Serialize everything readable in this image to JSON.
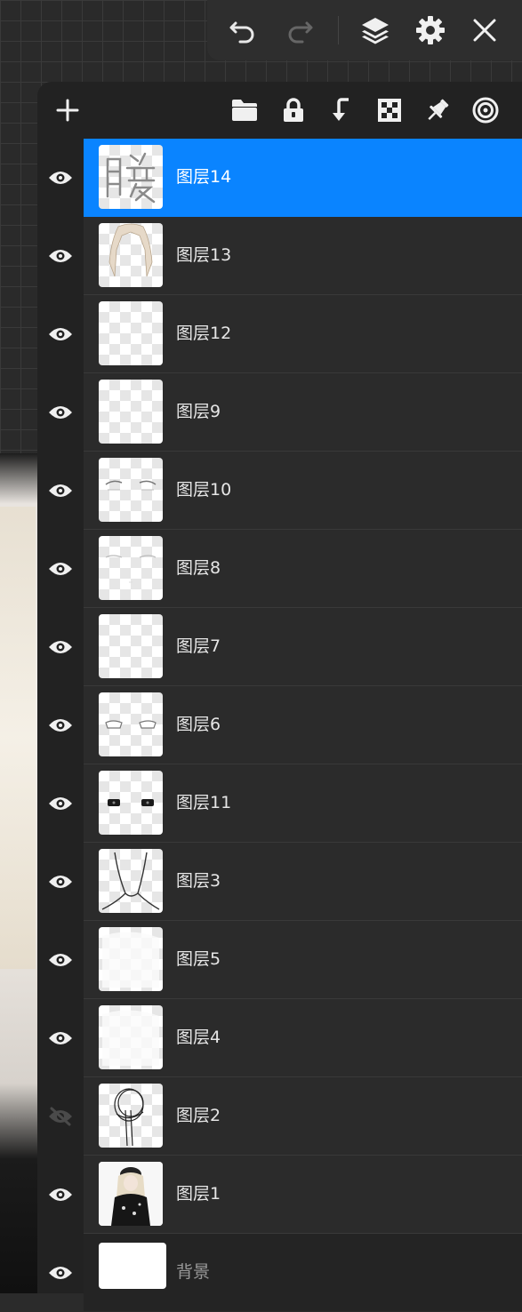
{
  "toolbar": {
    "undo_icon": "undo-icon",
    "redo_icon": "redo-icon",
    "layers_icon": "layers-icon",
    "settings_icon": "gear-icon",
    "close_icon": "close-icon"
  },
  "panel_toolbar": {
    "add_icon": "plus-icon",
    "group_icon": "folder-icon",
    "lock_icon": "lock-icon",
    "clip_icon": "clip-arrow-icon",
    "alpha_icon": "checkerboard-icon",
    "pin_icon": "pin-icon",
    "reference_icon": "target-icon"
  },
  "colors": {
    "accent": "#0a84ff",
    "panel": "#222222",
    "row": "#2b2b2b"
  },
  "layers": [
    {
      "name": "图层14",
      "visible": true,
      "selected": true,
      "thumb": "calligraphy"
    },
    {
      "name": "图层13",
      "visible": true,
      "selected": false,
      "thumb": "hair"
    },
    {
      "name": "图层12",
      "visible": true,
      "selected": false,
      "thumb": "empty"
    },
    {
      "name": "图层9",
      "visible": true,
      "selected": false,
      "thumb": "empty"
    },
    {
      "name": "图层10",
      "visible": true,
      "selected": false,
      "thumb": "brows"
    },
    {
      "name": "图层8",
      "visible": true,
      "selected": false,
      "thumb": "faint-brows"
    },
    {
      "name": "图层7",
      "visible": true,
      "selected": false,
      "thumb": "empty"
    },
    {
      "name": "图层6",
      "visible": true,
      "selected": false,
      "thumb": "eyes-outline"
    },
    {
      "name": "图层11",
      "visible": true,
      "selected": false,
      "thumb": "eyes-dark"
    },
    {
      "name": "图层3",
      "visible": true,
      "selected": false,
      "thumb": "neck"
    },
    {
      "name": "图层5",
      "visible": true,
      "selected": false,
      "thumb": "white"
    },
    {
      "name": "图层4",
      "visible": true,
      "selected": false,
      "thumb": "white"
    },
    {
      "name": "图层2",
      "visible": false,
      "selected": false,
      "thumb": "sketch"
    },
    {
      "name": "图层1",
      "visible": true,
      "selected": false,
      "thumb": "figure"
    }
  ],
  "background_layer": {
    "name": "背景",
    "visible": true
  }
}
